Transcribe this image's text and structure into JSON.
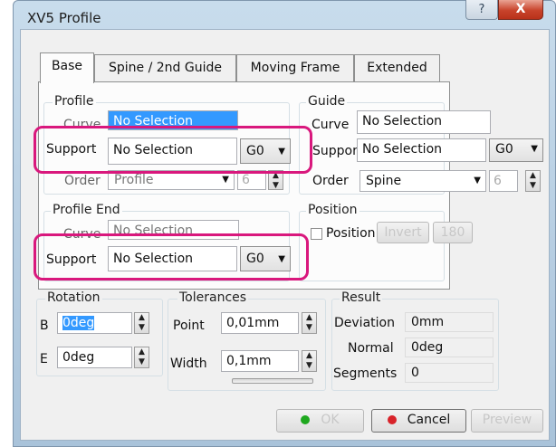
{
  "window": {
    "title": "XV5 Profile",
    "help_glyph": "?",
    "close_glyph": "X"
  },
  "tabs": [
    {
      "label": "Base"
    },
    {
      "label": "Spine / 2nd Guide"
    },
    {
      "label": "Moving Frame"
    },
    {
      "label": "Extended"
    }
  ],
  "profile": {
    "group_label": "Profile",
    "curve_label": "Curve",
    "curve_value": "No Selection",
    "support_label": "Support",
    "support_value": "No Selection",
    "support_continuity": "G0",
    "order_label": "Order",
    "order_value": "Profile",
    "order_degree": "6"
  },
  "guide": {
    "group_label": "Guide",
    "curve_label": "Curve",
    "curve_value": "No Selection",
    "support_label": "Support",
    "support_value": "No Selection",
    "support_continuity": "G0",
    "order_label": "Order",
    "order_value": "Spine",
    "order_degree": "6"
  },
  "profile_end": {
    "group_label": "Profile End",
    "curve_label": "Curve",
    "curve_value": "No Selection",
    "support_label": "Support",
    "support_value": "No Selection",
    "support_continuity": "G0"
  },
  "position": {
    "group_label": "Position",
    "checkbox_label": "Position",
    "checked": false,
    "invert_label": "Invert",
    "rotate_label": "180"
  },
  "rotation": {
    "group_label": "Rotation",
    "b_label": "B",
    "b_value": "0deg",
    "e_label": "E",
    "e_value": "0deg"
  },
  "tolerances": {
    "group_label": "Tolerances",
    "point_label": "Point",
    "point_value": "0,01mm",
    "width_label": "Width",
    "width_value": "0,1mm"
  },
  "result": {
    "group_label": "Result",
    "deviation_label": "Deviation",
    "deviation_value": "0mm",
    "normal_label": "Normal",
    "normal_value": "0deg",
    "segments_label": "Segments",
    "segments_value": "0"
  },
  "footer": {
    "ok_label": "OK",
    "cancel_label": "Cancel",
    "preview_label": "Preview"
  },
  "colors": {
    "highlight": "#d9187d",
    "ok_dot": "#1fa81f",
    "cancel_dot": "#d8232a",
    "selection": "#3399ff"
  },
  "icons": {
    "spin_up": "▲",
    "spin_down": "▼",
    "dropdown": "▼"
  }
}
